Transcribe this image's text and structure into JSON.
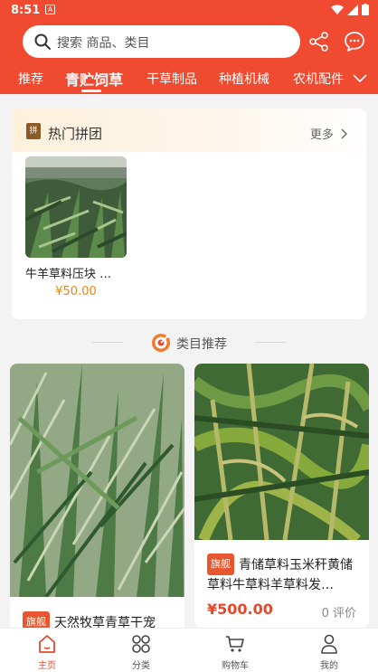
{
  "status_bar": {
    "time": "8:51",
    "notif": "A"
  },
  "search": {
    "placeholder": "搜索 商品、类目"
  },
  "tabs": [
    {
      "label": "推荐"
    },
    {
      "label": "青贮饲草"
    },
    {
      "label": "干草制品"
    },
    {
      "label": "种植机械"
    },
    {
      "label": "农机配件"
    }
  ],
  "hot_group": {
    "title": "热门拼团",
    "more": "更多",
    "badge": "拼",
    "products": [
      {
        "name": "牛羊草料压块 …",
        "price": "¥50.00"
      }
    ]
  },
  "category": {
    "title": "类目推荐"
  },
  "products": [
    {
      "flag": "旗舰",
      "name": "天然牧草青草干宠"
    },
    {
      "flag": "旗舰",
      "name": "青储草料玉米秆黄储草料牛草料羊草料发…",
      "price": "¥500.00",
      "reviews": "0 评价"
    }
  ],
  "bottom_nav": [
    {
      "label": "主页",
      "icon": "home-icon"
    },
    {
      "label": "分类",
      "icon": "category-icon"
    },
    {
      "label": "购物车",
      "icon": "cart-icon"
    },
    {
      "label": "我的",
      "icon": "profile-icon"
    }
  ],
  "colors": {
    "accent": "#f04a30",
    "price": "#e8472a",
    "group_price": "#e3891b"
  }
}
